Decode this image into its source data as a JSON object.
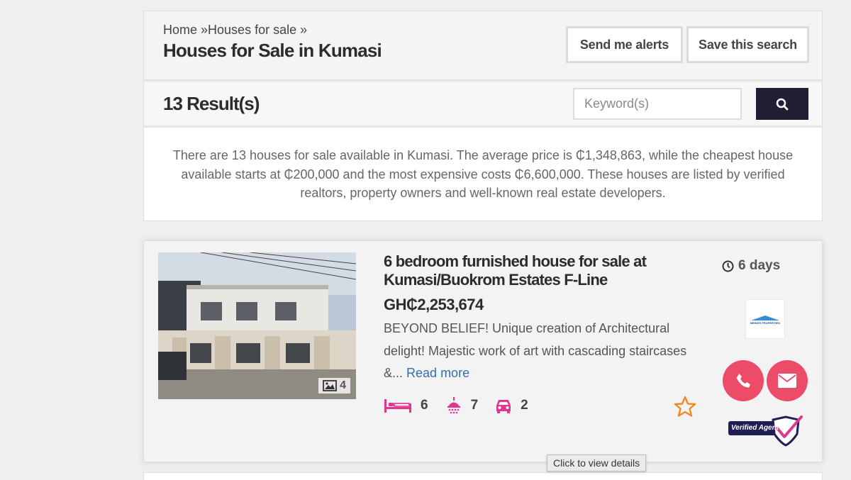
{
  "header": {
    "breadcrumb": {
      "home": "Home",
      "sep1": " »",
      "category": "Houses for sale",
      "sep2": " »"
    },
    "title": "Houses for Sale in Kumasi",
    "send_alerts_label": "Send me alerts",
    "save_search_label": "Save this search"
  },
  "results": {
    "count_label": "13 Result(s)",
    "keyword_placeholder": "Keyword(s)",
    "search_icon": "search-icon"
  },
  "summary": {
    "text": "There are 13 houses for sale available in Kumasi. The average price is ₵1,348,863, while the cheapest house available starts at ₵200,000 and the most expensive costs ₵6,600,000. These houses are listed by verified realtors, property owners and well-known real estate developers."
  },
  "listing": {
    "photo_count": "4",
    "title": "6 bedroom furnished house for sale at Kumasi/Buokrom Estates F-Line",
    "price": "GH₵2,253,674",
    "description": "BEYOND BELIEF! Unique creation of Architectural delight! Majestic work of art with cascading staircases &...",
    "read_more": "Read more",
    "bedrooms": "6",
    "bathrooms": "7",
    "parking": "2",
    "posted": "6 days",
    "agent_logo_text": "BEIKER PROPERTIES",
    "verified_label": "Verified Agent",
    "icons": [
      "bed-icon",
      "shower-icon",
      "car-icon",
      "star-icon",
      "clock-icon",
      "phone-icon",
      "envelope-icon",
      "image-icon",
      "verified-check-icon"
    ]
  },
  "colors": {
    "accent_pink": "#ec4c68",
    "feature_magenta": "#e0368e",
    "search_navy": "#1f1e33",
    "star_orange": "#f08a24",
    "link_blue": "#2f6fb5"
  },
  "tooltip": "Click to view details"
}
